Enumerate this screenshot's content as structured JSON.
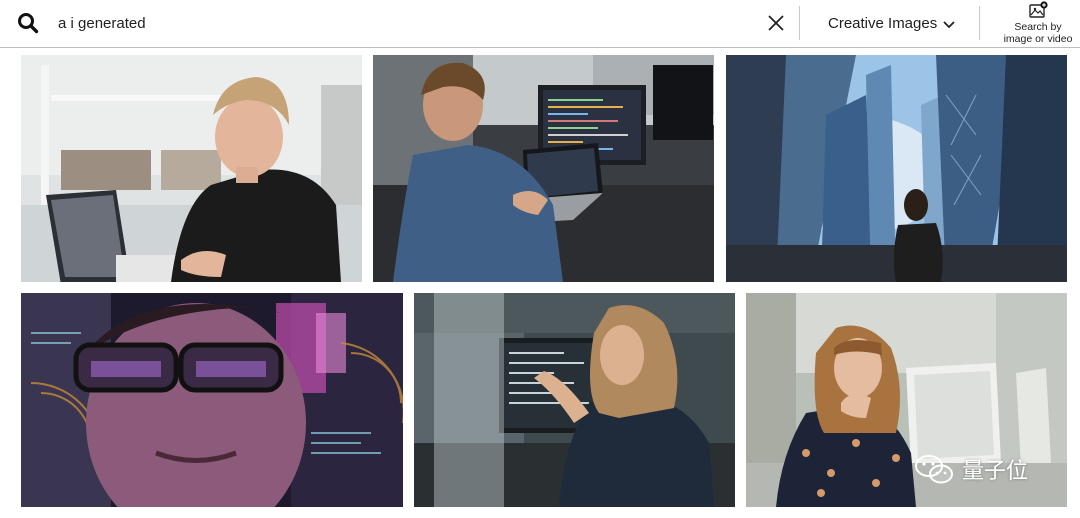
{
  "search": {
    "query": "a i generated",
    "filter_label": "Creative Images",
    "search_by_line1": "Search by",
    "search_by_line2": "image or video"
  },
  "icons": {
    "search": "search-icon",
    "clear": "close-icon",
    "dropdown": "chevron-down-icon",
    "search_by": "camera-upload-icon"
  },
  "results": [
    {
      "id": "woman-smiling-laptop-office"
    },
    {
      "id": "man-coding-dual-screens"
    },
    {
      "id": "skyscrapers-fisheye-woman"
    },
    {
      "id": "woman-glasses-holographic-data"
    },
    {
      "id": "woman-pensive-computer-screen"
    },
    {
      "id": "woman-thinking-office-monitors"
    }
  ],
  "watermark": {
    "text": "量子位",
    "logo": "wechat-logo"
  },
  "colors": {
    "border": "#bdbdbd",
    "text": "#1f1f1f",
    "watermark": "#ffffff"
  }
}
